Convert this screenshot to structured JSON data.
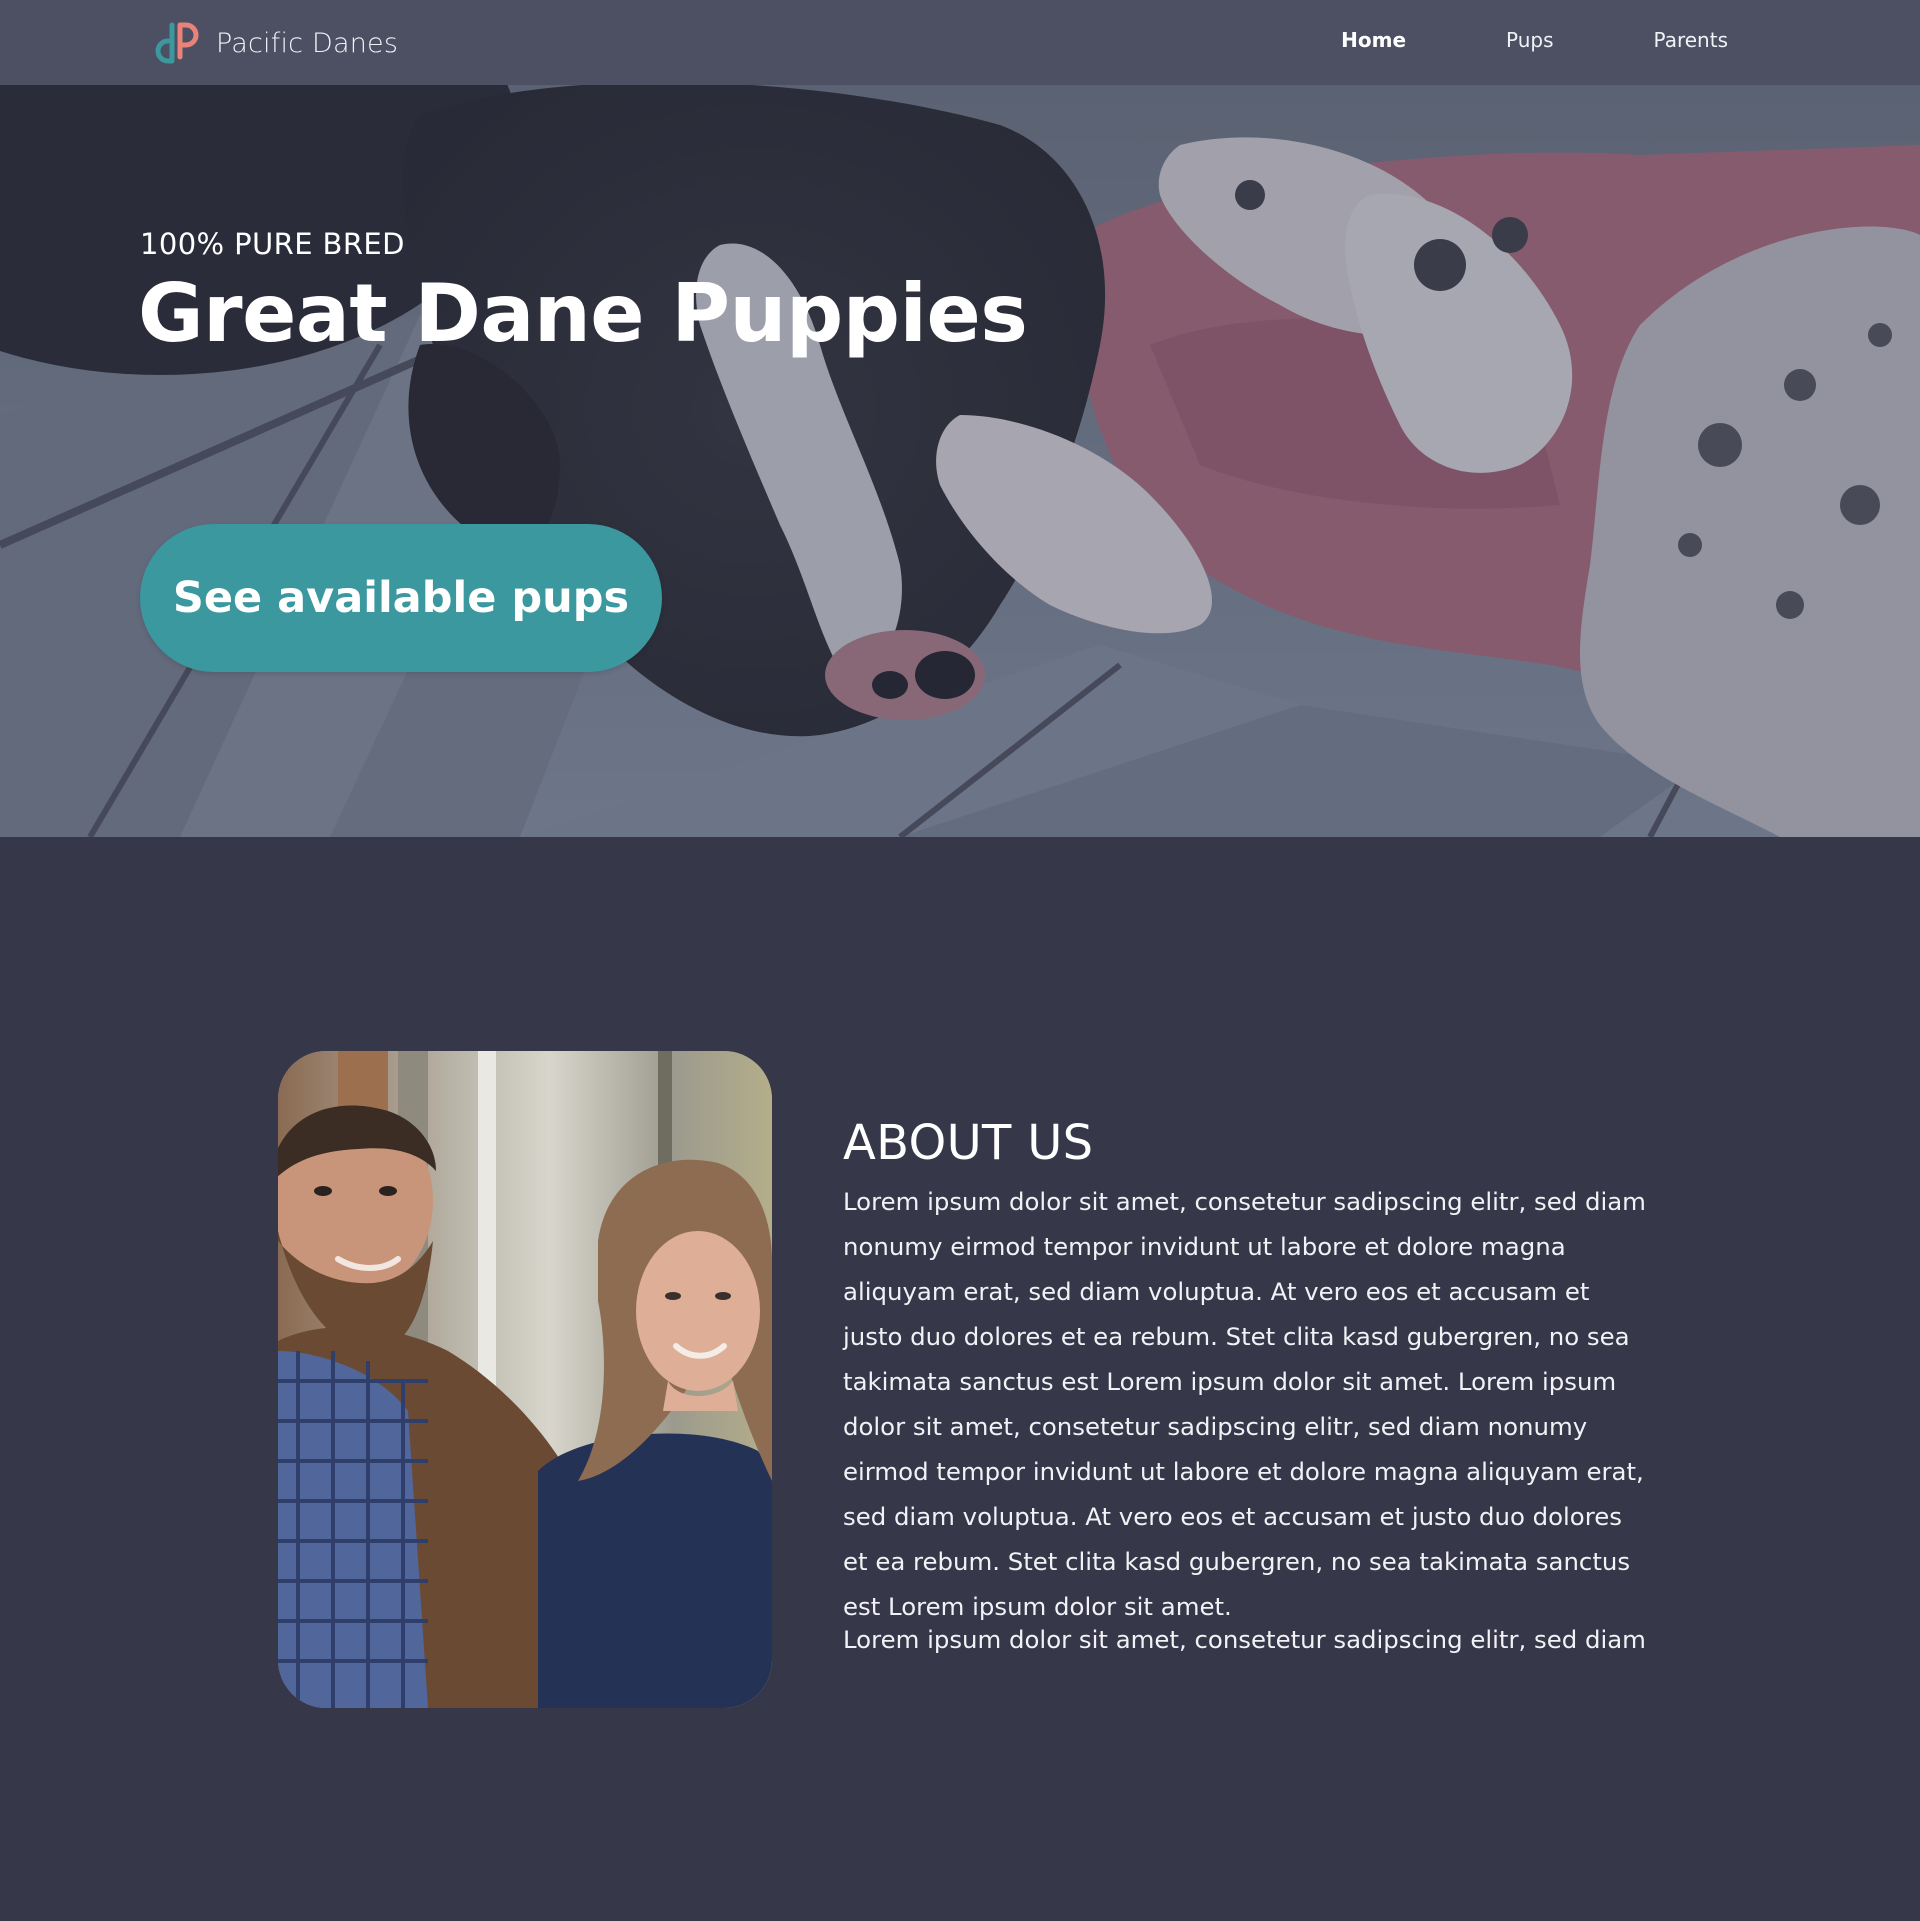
{
  "site": {
    "brand_name": "Pacific Danes",
    "logo_icon": "dp-monogram-icon",
    "colors": {
      "nav_bg": "#4d4f63",
      "page_bg": "#363749",
      "accent_teal": "#3a989e",
      "logo_coral": "#e8837a"
    }
  },
  "nav": {
    "items": [
      {
        "label": "Home",
        "active": true
      },
      {
        "label": "Pups",
        "active": false
      },
      {
        "label": "Parents",
        "active": false
      }
    ]
  },
  "hero": {
    "eyebrow": "100% PURE BRED",
    "title": "Great Dane Puppies",
    "cta_label": "See available pups"
  },
  "about": {
    "title": "ABOUT US",
    "paragraph_1": "Lorem ipsum dolor sit amet, consetetur sadipscing elitr, sed diam nonumy eirmod tempor invidunt ut labore et dolore magna aliquyam erat, sed diam voluptua. At vero eos et accusam et justo duo dolores et ea rebum. Stet clita kasd gubergren, no sea takimata sanctus est Lorem ipsum dolor sit amet. Lorem ipsum dolor sit amet, consetetur sadipscing elitr, sed diam nonumy eirmod tempor invidunt ut labore et dolore magna aliquyam erat, sed diam voluptua. At vero eos et accusam et justo duo dolores et ea rebum. Stet clita kasd gubergren, no sea takimata sanctus est Lorem ipsum dolor sit amet.",
    "paragraph_2": "Lorem ipsum dolor sit amet, consetetur sadipscing elitr, sed diam"
  }
}
